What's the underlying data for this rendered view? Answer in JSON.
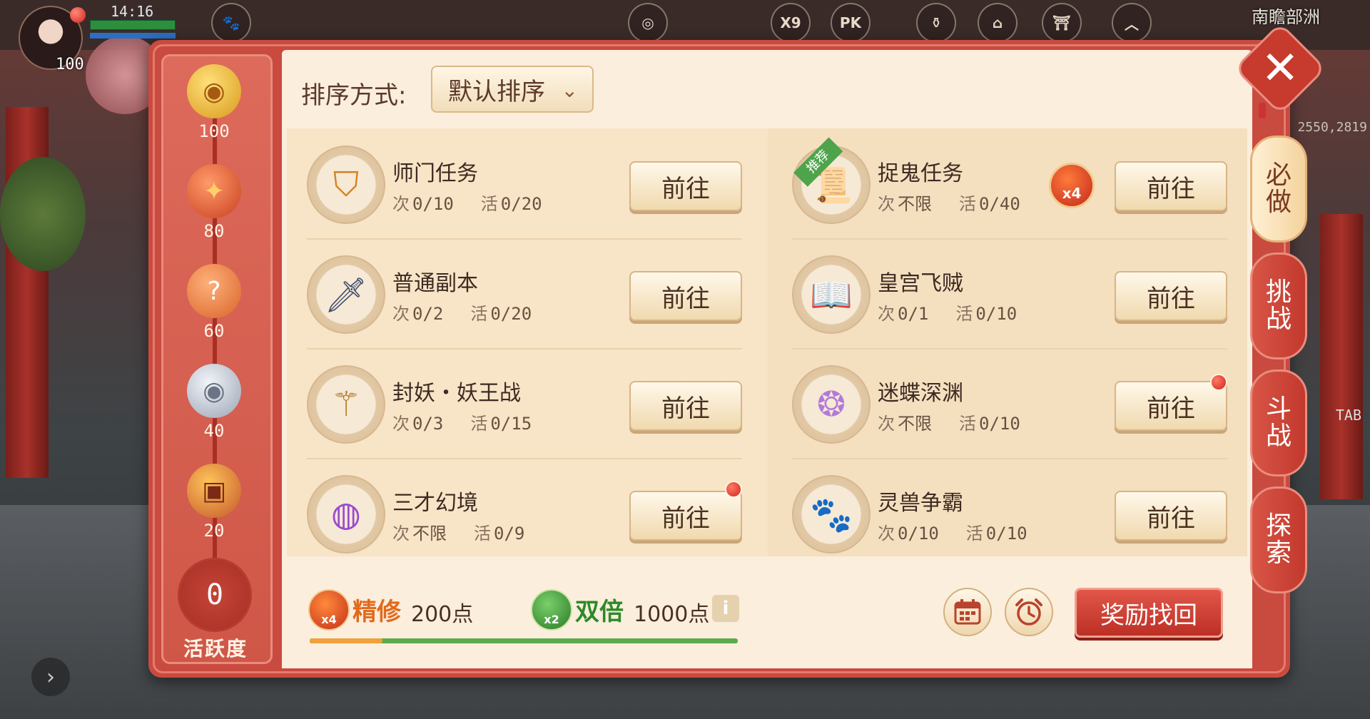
{
  "hud": {
    "time": "14:16",
    "level": "100",
    "region": "南瞻部洲",
    "coords": "2550,2819",
    "tab_hint": "TAB",
    "icons": [
      "X9",
      "PK"
    ],
    "badge_count": "1"
  },
  "activity": {
    "milestones": [
      {
        "value": "100",
        "icon": "coin-icon"
      },
      {
        "value": "80",
        "icon": "treasure-bag-icon"
      },
      {
        "value": "60",
        "icon": "mystery-bag-icon"
      },
      {
        "value": "40",
        "icon": "silver-coin-icon"
      },
      {
        "value": "20",
        "icon": "chest-icon"
      }
    ],
    "score": "0",
    "label": "活跃度"
  },
  "sort": {
    "label": "排序方式:",
    "selected": "默认排序"
  },
  "tasks_left": [
    {
      "name": "师门任务",
      "times_key": "次",
      "times": "0/10",
      "act_key": "活",
      "act": "0/20",
      "button": "前往",
      "icon": "sect-banner-icon"
    },
    {
      "name": "普通副本",
      "times_key": "次",
      "times": "0/2",
      "act_key": "活",
      "act": "0/20",
      "button": "前往",
      "icon": "sword-icon"
    },
    {
      "name": "封妖・妖王战",
      "times_key": "次",
      "times": "0/3",
      "act_key": "活",
      "act": "0/15",
      "button": "前往",
      "icon": "dragon-staff-icon"
    },
    {
      "name": "三才幻境",
      "times_key": "次",
      "times": "不限",
      "act_key": "活",
      "act": "0/9",
      "button": "前往",
      "icon": "illusion-orb-icon"
    }
  ],
  "tasks_right": [
    {
      "name": "捉鬼任务",
      "times_key": "次",
      "times": "不限",
      "act_key": "活",
      "act": "0/40",
      "button": "前往",
      "icon": "ghost-scroll-icon",
      "tag": "推荐",
      "multiplier": "x4"
    },
    {
      "name": "皇宫飞贼",
      "times_key": "次",
      "times": "0/1",
      "act_key": "活",
      "act": "0/10",
      "button": "前往",
      "icon": "book-icon"
    },
    {
      "name": "迷蝶深渊",
      "times_key": "次",
      "times": "不限",
      "act_key": "活",
      "act": "0/10",
      "button": "前往",
      "icon": "butterfly-orb-icon"
    },
    {
      "name": "灵兽争霸",
      "times_key": "次",
      "times": "0/10",
      "act_key": "活",
      "act": "0/10",
      "button": "前往",
      "icon": "paw-icon"
    }
  ],
  "bonus": {
    "refine": {
      "title": "精修",
      "value": "200点",
      "badge": "x4"
    },
    "double": {
      "title": "双倍",
      "value": "1000点",
      "badge": "x2"
    },
    "info": "i",
    "refine_progress": 0.17
  },
  "footer": {
    "reward_button": "奖励找回"
  },
  "tabs": [
    {
      "label_top": "必",
      "label_bottom": "做",
      "active": true
    },
    {
      "label_top": "挑",
      "label_bottom": "战",
      "active": false
    },
    {
      "label_top": "斗",
      "label_bottom": "战",
      "active": false
    },
    {
      "label_top": "探",
      "label_bottom": "索",
      "active": false
    }
  ],
  "colors": {
    "panel": "#c94a3f",
    "content": "#fbeedd",
    "button": "#f0d9ae",
    "reward": "#c9362b",
    "refine": "#e26a1c",
    "double": "#2d8a2a"
  }
}
